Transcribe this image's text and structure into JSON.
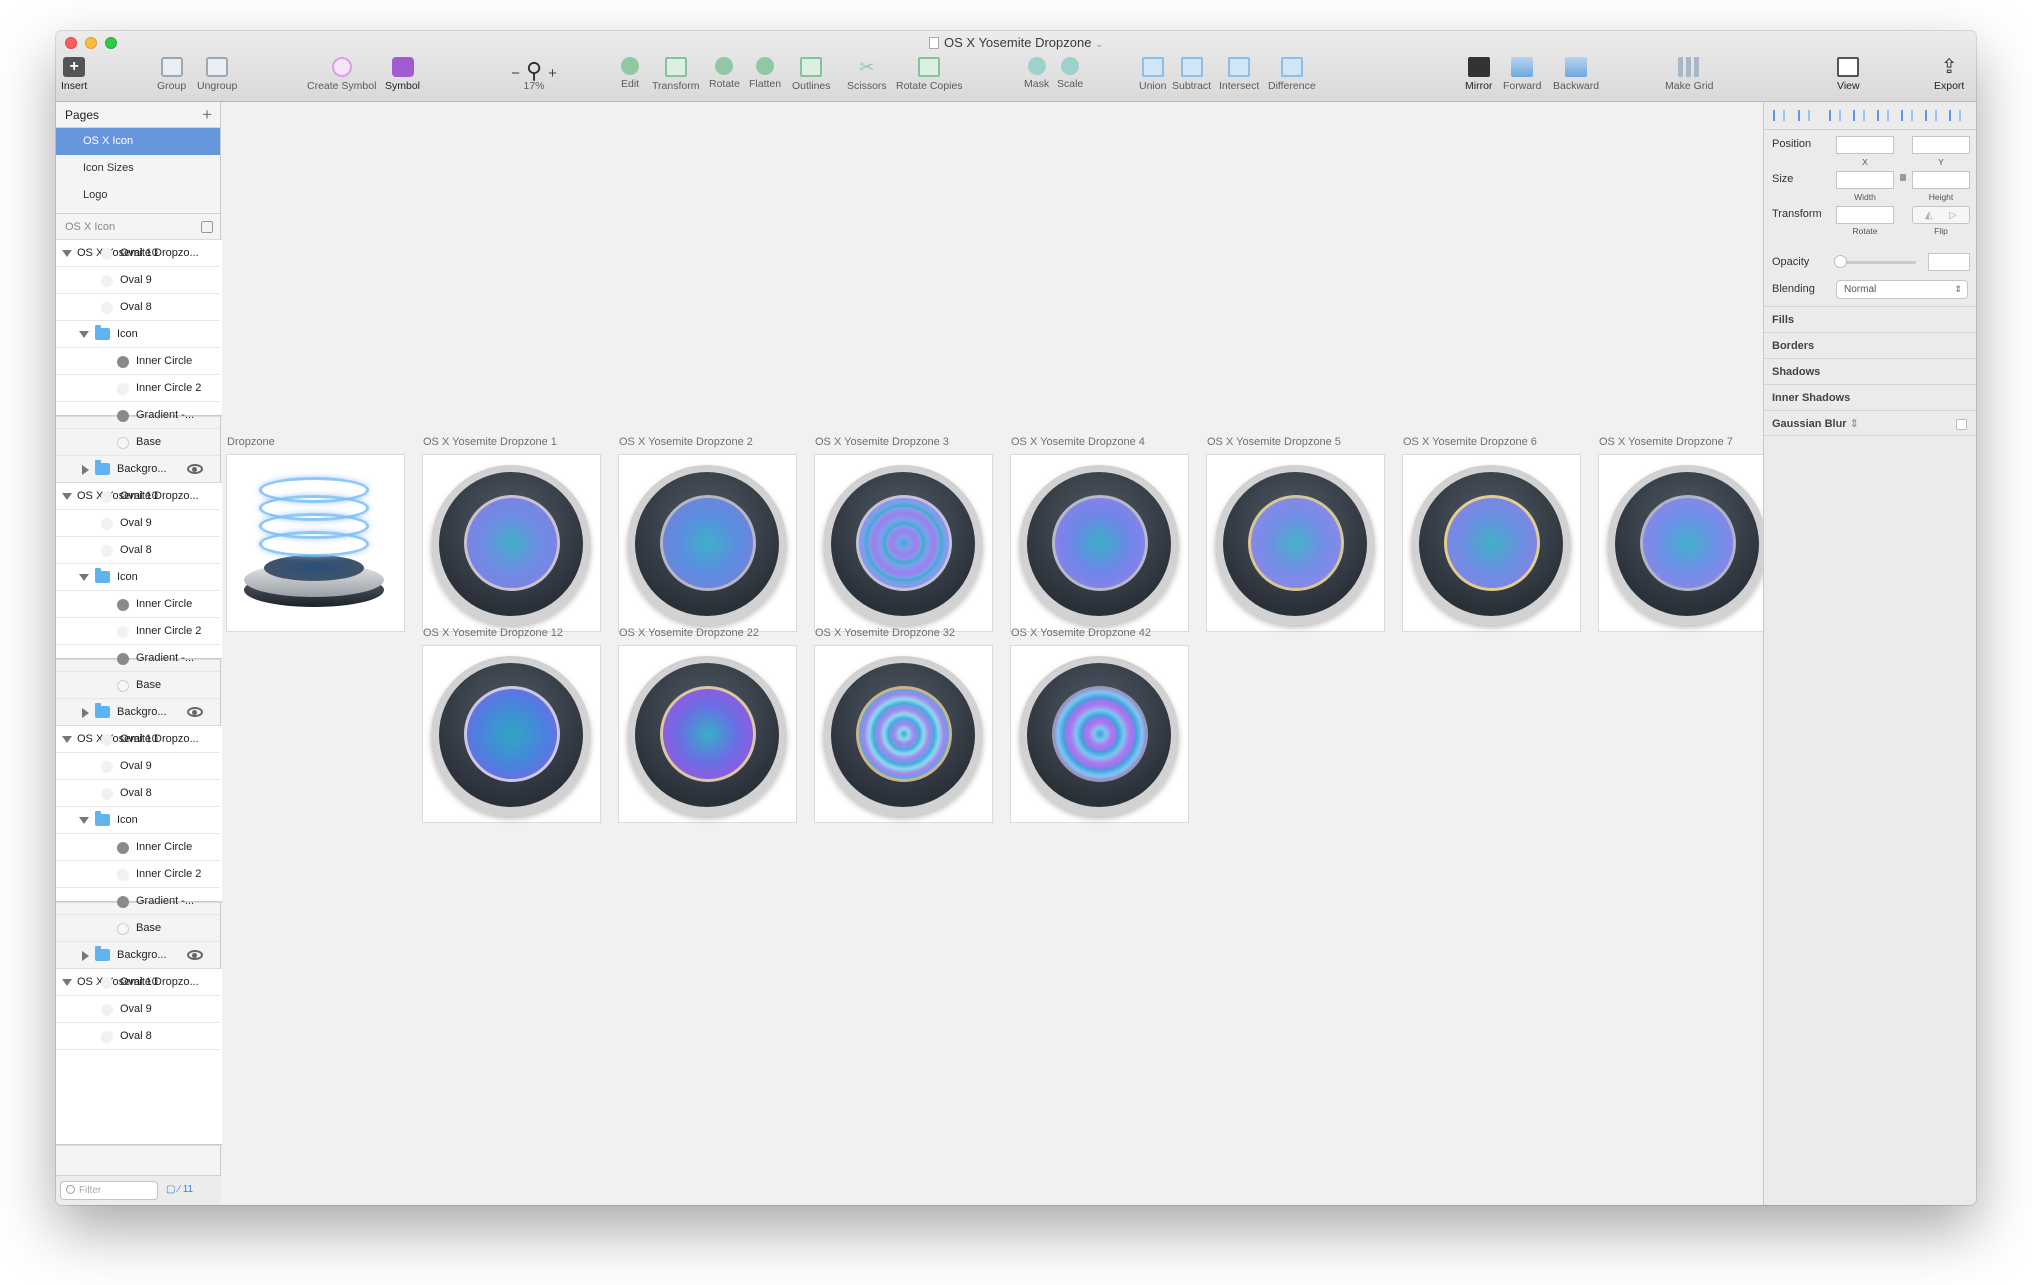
{
  "window": {
    "title": "OS X Yosemite Dropzone"
  },
  "toolbar": {
    "insert": "Insert",
    "group": "Group",
    "ungroup": "Ungroup",
    "create_symbol": "Create Symbol",
    "symbol": "Symbol",
    "zoom_minus": "−",
    "zoom_plus": "+",
    "zoom_value": "17%",
    "edit": "Edit",
    "transform": "Transform",
    "rotate": "Rotate",
    "flatten": "Flatten",
    "outlines": "Outlines",
    "scissors": "Scissors",
    "rotate_copies": "Rotate Copies",
    "mask": "Mask",
    "scale": "Scale",
    "union": "Union",
    "subtract": "Subtract",
    "intersect": "Intersect",
    "difference": "Difference",
    "mirror": "Mirror",
    "forward": "Forward",
    "backward": "Backward",
    "make_grid": "Make Grid",
    "view": "View",
    "export": "Export"
  },
  "sidebar": {
    "pages_header": "Pages",
    "pages": [
      "OS X Icon",
      "Icon Sizes",
      "Logo"
    ],
    "layers_header": "OS X Icon",
    "layers": [
      "OS X Yosemite Dropzo...",
      "Oval 10",
      "Oval 9",
      "Oval 8",
      "Icon",
      "Inner Circle",
      "Inner Circle 2",
      "Gradient -...",
      "Base",
      "Backgro...",
      "OS X Yosemite Dropzo...",
      "Oval 10",
      "Oval 9",
      "Oval 8",
      "Icon",
      "Inner Circle",
      "Inner Circle 2",
      "Gradient -...",
      "Base",
      "Backgro...",
      "OS X Yosemite Dropzo...",
      "Oval 10",
      "Oval 9",
      "Oval 8",
      "Icon",
      "Inner Circle",
      "Inner Circle 2",
      "Gradient -...",
      "Base",
      "Backgro...",
      "OS X Yosemite Dropzo...",
      "OS X Yosemite Dropzo...",
      "Oval 10",
      "Oval 9",
      "Oval 8"
    ],
    "filter_placeholder": "Filter",
    "filter_count": "11"
  },
  "canvas": {
    "artboards": [
      "Dropzone",
      "OS X Yosemite Dropzone 1",
      "OS X Yosemite Dropzone 2",
      "OS X Yosemite Dropzone 3",
      "OS X Yosemite Dropzone 4",
      "OS X Yosemite Dropzone 5",
      "OS X Yosemite Dropzone 6",
      "OS X Yosemite Dropzone 7",
      "OS X Yosemite Dropzone 12",
      "OS X Yosemite Dropzone 22",
      "OS X Yosemite Dropzone 32",
      "OS X Yosemite Dropzone 42"
    ]
  },
  "inspector": {
    "position": "Position",
    "x": "X",
    "y": "Y",
    "size": "Size",
    "width": "Width",
    "height": "Height",
    "transform": "Transform",
    "rotate": "Rotate",
    "flip": "Flip",
    "opacity": "Opacity",
    "blending": "Blending",
    "blending_value": "Normal",
    "fills": "Fills",
    "borders": "Borders",
    "shadows": "Shadows",
    "inner_shadows": "Inner Shadows",
    "gaussian_blur": "Gaussian Blur"
  }
}
